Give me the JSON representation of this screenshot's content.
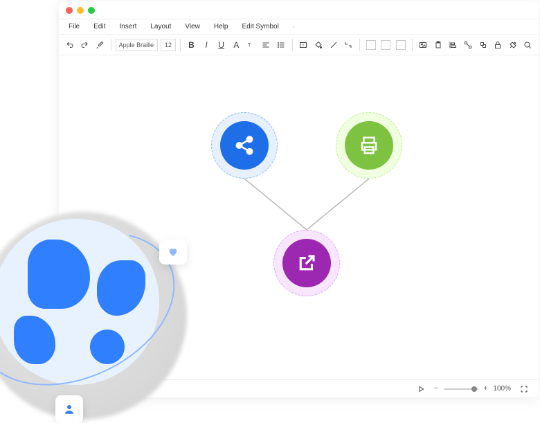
{
  "menu": {
    "file": "File",
    "edit": "Edit",
    "insert": "Insert",
    "layout": "Layout",
    "view": "View",
    "help": "Help",
    "edit_symbol": "Edit Symbol"
  },
  "toolbar": {
    "font": "Apple Braille",
    "size": "12"
  },
  "status": {
    "minus": "−",
    "plus": "+",
    "zoom": "100%"
  },
  "colors": {
    "share": "#1E6EE8",
    "print": "#7DC241",
    "export": "#9C27B0"
  },
  "nodes": {
    "share": "share",
    "print": "print",
    "export": "external-link"
  }
}
